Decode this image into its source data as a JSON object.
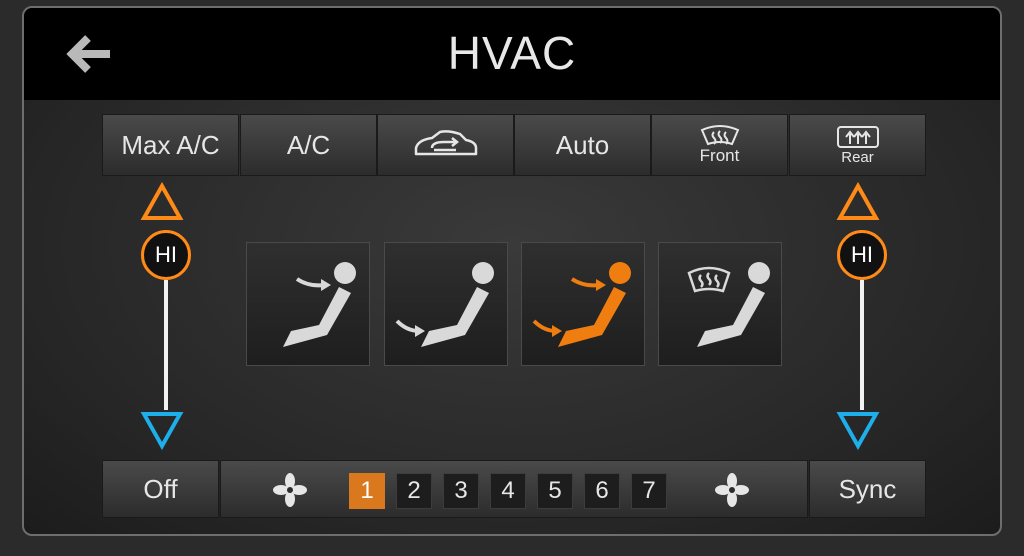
{
  "header": {
    "title": "HVAC",
    "back_icon": "back-arrow-icon"
  },
  "top_buttons": {
    "max_ac": "Max A/C",
    "ac": "A/C",
    "recirc_icon": "recirculation-icon",
    "auto": "Auto",
    "front": "Front",
    "rear": "Rear"
  },
  "temperature": {
    "left": {
      "value": "HI"
    },
    "right": {
      "value": "HI"
    }
  },
  "modes": [
    {
      "name": "face",
      "active": false
    },
    {
      "name": "feet",
      "active": false
    },
    {
      "name": "face-and-feet",
      "active": true
    },
    {
      "name": "defrost-and-feet",
      "active": false
    }
  ],
  "bottom": {
    "off": "Off",
    "sync": "Sync",
    "fan_speeds": [
      "1",
      "2",
      "3",
      "4",
      "5",
      "6",
      "7"
    ],
    "active_speed": "1"
  },
  "colors": {
    "accent": "#ff8a17",
    "cool": "#1eaeea",
    "active_mode": "#f07d10",
    "inactive_mode": "#d9d9d9"
  }
}
